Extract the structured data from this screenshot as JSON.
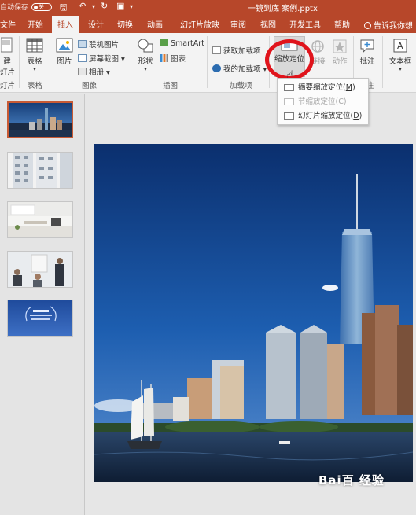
{
  "titlebar": {
    "autosave_label": "自动保存",
    "autosave_state": "关",
    "document_title": "一镜到底 案例.pptx",
    "quick_access": {
      "save_icon": "save-icon",
      "undo_icon": "undo-icon",
      "redo_icon": "redo-icon",
      "start_icon": "present-from-start-icon"
    }
  },
  "tabs": [
    {
      "label": "文件"
    },
    {
      "label": "开始"
    },
    {
      "label": "插入",
      "active": true
    },
    {
      "label": "设计"
    },
    {
      "label": "切换"
    },
    {
      "label": "动画"
    },
    {
      "label": "幻灯片放映"
    },
    {
      "label": "审阅"
    },
    {
      "label": "视图"
    },
    {
      "label": "开发工具"
    },
    {
      "label": "帮助"
    }
  ],
  "tell_me": "告诉我你想",
  "ribbon": {
    "new_slide": {
      "line1": "建",
      "line2": "灯片"
    },
    "table": {
      "label": "表格",
      "group": "表格"
    },
    "images": {
      "picture": "图片",
      "online_pictures": "联机图片",
      "screenshot": "屏幕截图",
      "album": "相册",
      "group": "图像"
    },
    "illustrations": {
      "shapes": "形状",
      "smartart": "SmartArt",
      "chart": "图表",
      "group": "插图"
    },
    "addins": {
      "get_addins": "获取加载项",
      "my_addins": "我的加载项",
      "group": "加载项"
    },
    "links": {
      "zoom": "缩放定位",
      "link": "链接",
      "action": "动作"
    },
    "comments": {
      "comment": "批注",
      "group": "注"
    },
    "text": {
      "textbox": "文本框"
    },
    "slides_group_fragment": "灯片"
  },
  "zoom_menu": [
    {
      "label": "摘要缩放定位",
      "key": "M",
      "enabled": true
    },
    {
      "label": "节缩放定位",
      "key": "C",
      "enabled": false
    },
    {
      "label": "幻灯片缩放定位",
      "key": "D",
      "enabled": true
    }
  ],
  "slide_count": 5,
  "watermark": "Bai百 经验",
  "accent_color": "#b7472a",
  "highlight_color": "#e0141c"
}
